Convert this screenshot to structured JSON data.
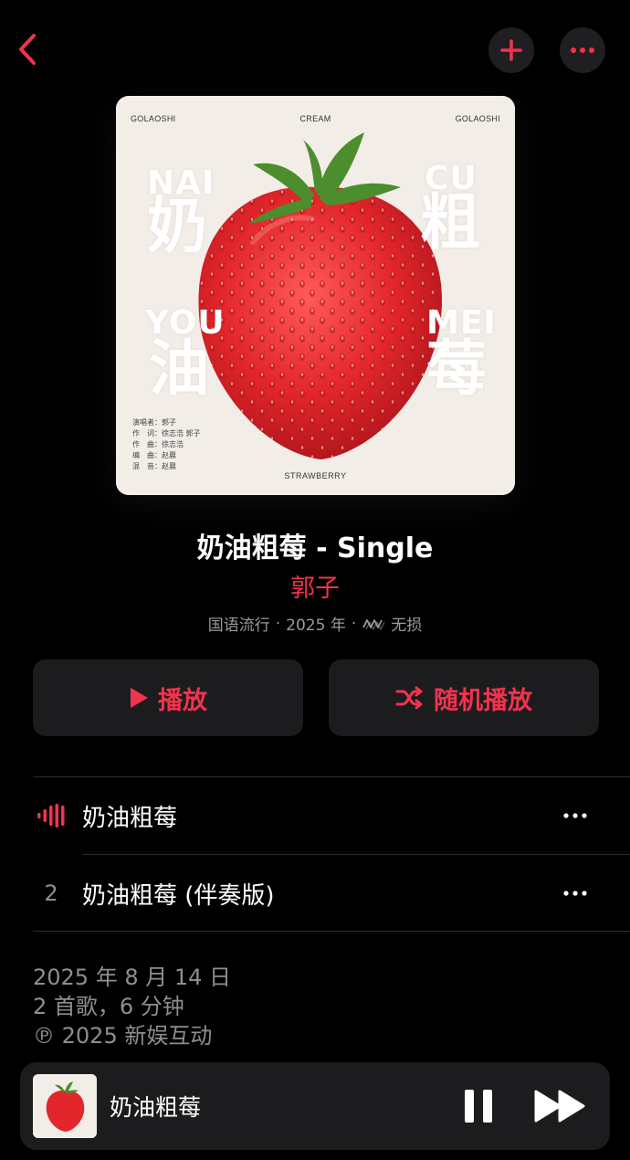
{
  "nav": {
    "back_icon": "chevron-left-icon",
    "add_icon": "plus-icon",
    "more_icon": "ellipsis-icon",
    "accent": "#f2334d"
  },
  "cover": {
    "top_left": "GOLAOSHI",
    "top_center": "CREAM",
    "top_right": "GOLAOSHI",
    "nai_latin": "NAI",
    "nai_han": "奶",
    "cu_latin": "CU",
    "cu_han": "粗",
    "you_latin": "YOU",
    "you_han": "油",
    "mei_latin": "MEI",
    "mei_han": "莓",
    "credits": [
      "演唱者：郭子",
      "作　词：徐志浩 郭子",
      "作　曲：徐志浩",
      "编　曲：赵晨",
      "混　音：赵晨"
    ],
    "bottom": "STRAWBERRY"
  },
  "album": {
    "title": "奶油粗莓 - Single",
    "artist": "郭子",
    "genre": "国语流行",
    "year": "2025 年",
    "quality": "无损",
    "quality_icon": "lossless-icon"
  },
  "actions": {
    "play_label": "播放",
    "shuffle_label": "随机播放"
  },
  "tracks": [
    {
      "number": "",
      "playing": true,
      "title": "奶油粗莓"
    },
    {
      "number": "2",
      "playing": false,
      "title": "奶油粗莓 (伴奏版)"
    }
  ],
  "info": {
    "release_date": "2025 年 8 月 14 日",
    "summary": "2 首歌，6 分钟",
    "copyright": "℗ 2025 新娱互动"
  },
  "mini_player": {
    "title": "奶油粗莓"
  }
}
